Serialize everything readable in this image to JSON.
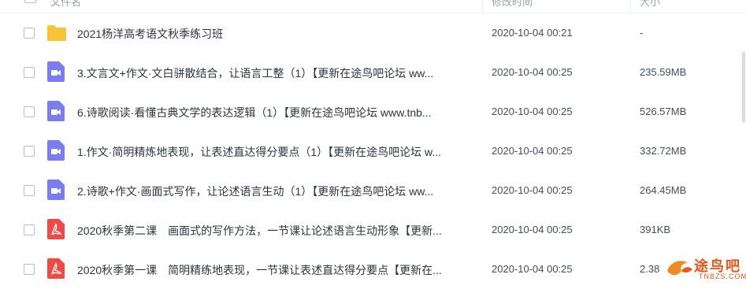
{
  "header": {
    "col_name": "文件名",
    "col_modified": "修改时间",
    "col_size": "大小"
  },
  "files": [
    {
      "icon": "folder-icon",
      "name": "2021杨洋高考语文秋季练习班",
      "modified": "2020-10-04 00:21",
      "size": "-"
    },
    {
      "icon": "video-icon",
      "name": "3.文言文+作文·文白骈散结合，让语言工整（1）【更新在途鸟吧论坛 ww...",
      "modified": "2020-10-04 00:25",
      "size": "235.59MB"
    },
    {
      "icon": "video-icon",
      "name": "6.诗歌阅读·看懂古典文学的表达逻辑（1）【更新在途鸟吧论坛 www.tnb...",
      "modified": "2020-10-04 00:25",
      "size": "526.57MB"
    },
    {
      "icon": "video-icon",
      "name": "1.作文·简明精炼地表现，让表述直达得分要点（1）【更新在途鸟吧论坛 w...",
      "modified": "2020-10-04 00:25",
      "size": "332.72MB"
    },
    {
      "icon": "video-icon",
      "name": "2.诗歌+作文·画面式写作，让论述语言生动（1）【更新在途鸟吧论坛 ww...",
      "modified": "2020-10-04 00:25",
      "size": "264.45MB"
    },
    {
      "icon": "pdf-icon",
      "name": "2020秋季第二课　画面式的写作方法，一节课让论述语言生动形象【更新...",
      "modified": "2020-10-04 00:25",
      "size": "391KB"
    },
    {
      "icon": "pdf-icon",
      "name": "2020秋季第一课　简明精练地表现，一节课让表述直达得分要点【更新在...",
      "modified": "2020-10-04 00:25",
      "size": "2.38"
    }
  ],
  "watermark": {
    "text": "途鸟吧",
    "domain": "TNBZS.COM"
  },
  "colors": {
    "folder": "#f7c437",
    "video": "#7a7cf0",
    "pdf": "#ee4b46",
    "sort_accent": "#4c8bf5"
  }
}
